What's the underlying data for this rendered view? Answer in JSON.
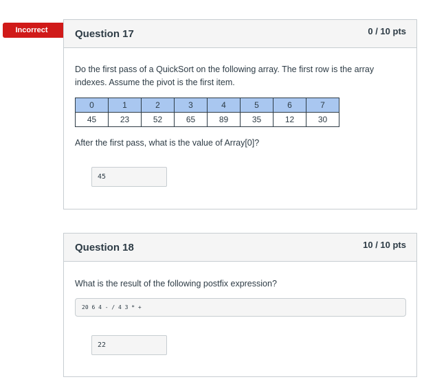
{
  "questions": [
    {
      "status_badge": "Incorrect",
      "title": "Question 17",
      "points": "0 / 10 pts",
      "prompt": "Do the first pass of a QuickSort on the following array. The first row is the array indexes. Assume the pivot is the first item.",
      "array_table": {
        "indexes": [
          "0",
          "1",
          "2",
          "3",
          "4",
          "5",
          "6",
          "7"
        ],
        "values": [
          "45",
          "23",
          "52",
          "65",
          "89",
          "35",
          "12",
          "30"
        ]
      },
      "follow_up": "After the first pass, what is the value of Array[0]?",
      "answer": "45"
    },
    {
      "title": "Question 18",
      "points": "10 / 10 pts",
      "prompt": "What is the result of the following postfix expression?",
      "expression": "20 6 4 - / 4 3 * +",
      "answer": "22"
    }
  ],
  "colors": {
    "incorrect_badge": "#d01a19",
    "index_row": "#a9c7f0",
    "header_bg": "#f5f5f5",
    "border": "#c7cdd1",
    "text": "#2d3b45"
  }
}
